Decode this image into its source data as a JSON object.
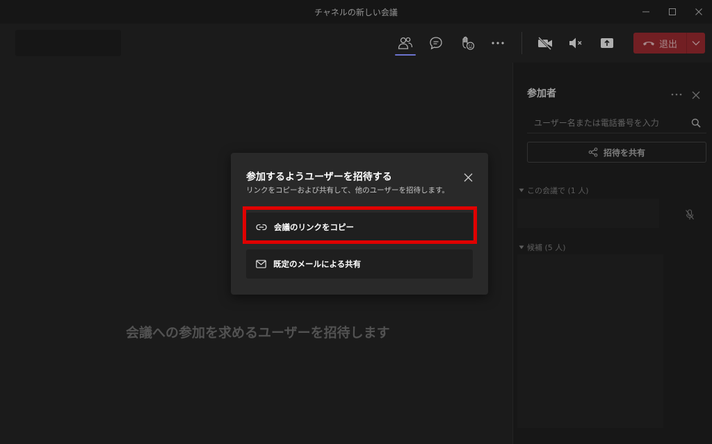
{
  "window": {
    "title": "チャネルの新しい会議"
  },
  "toolbar": {
    "leave_label": "退出"
  },
  "stage": {
    "invite_prompt": "会議への参加を求めるユーザーを招待します"
  },
  "participants_panel": {
    "title": "参加者",
    "search_placeholder": "ユーザー名または電話番号を入力",
    "share_invite_label": "招待を共有",
    "in_meeting_label": "この会議で (1 人)",
    "suggestions_label": "候補 (5 人)"
  },
  "dialog": {
    "title": "参加するようユーザーを招待する",
    "subtitle": "リンクをコピーおよび共有して、他のユーザーを招待します。",
    "copy_link_label": "会議のリンクをコピー",
    "share_email_label": "既定のメールによる共有"
  },
  "colors": {
    "leave_button": "#a4262c",
    "active_indicator": "#7b83eb",
    "highlight": "#e00000"
  }
}
